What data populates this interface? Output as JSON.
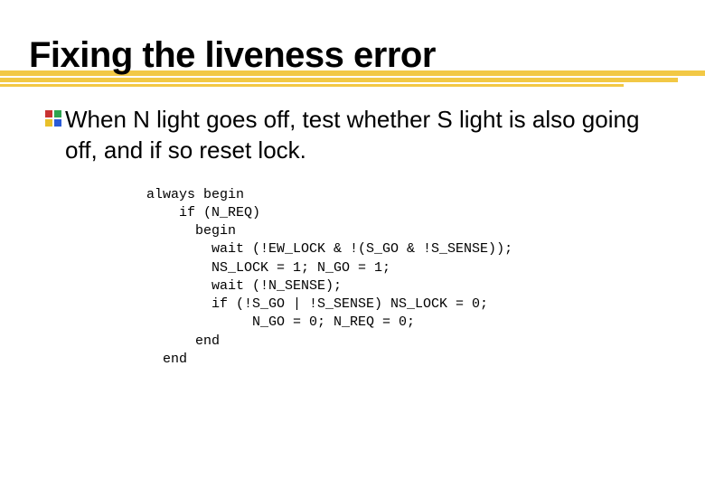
{
  "slide": {
    "title": "Fixing the liveness error",
    "bullet_text": "When N light goes off, test whether S light is also going off, and if so reset lock.",
    "code": "always begin\n    if (N_REQ)\n      begin\n        wait (!EW_LOCK & !(S_GO & !S_SENSE));\n        NS_LOCK = 1; N_GO = 1;\n        wait (!N_SENSE);\n        if (!S_GO | !S_SENSE) NS_LOCK = 0;\n             N_GO = 0; N_REQ = 0;\n      end\n  end"
  }
}
